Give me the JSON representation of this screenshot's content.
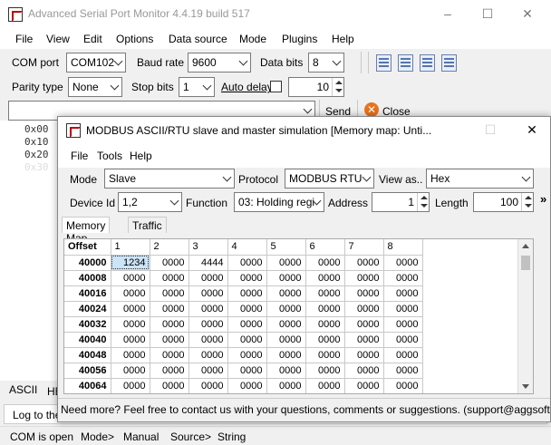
{
  "app": {
    "title": "Advanced Serial Port Monitor 4.4.19 build 517",
    "menu": [
      "File",
      "View",
      "Edit",
      "Options",
      "Data source",
      "Mode",
      "Plugins",
      "Help"
    ]
  },
  "settings": {
    "com_port_label": "COM port",
    "com_port": "COM102",
    "baud_label": "Baud rate",
    "baud": "9600",
    "databits_label": "Data bits",
    "databits": "8",
    "parity_label": "Parity type",
    "parity": "None",
    "stopbits_label": "Stop bits",
    "stopbits": "1",
    "autodelay_label": "Auto delay",
    "autodelay_value": "10",
    "send_label": "Send",
    "close_label": "Close"
  },
  "terminal": {
    "lines": [
      "0x00",
      "0x10",
      "0x20",
      "0x30"
    ]
  },
  "bottom": {
    "tab_ascii": "ASCII",
    "tab_h": "HE",
    "log_label": "Log to the"
  },
  "statusbar": {
    "com": "COM is open",
    "mode": "Mode>",
    "mode_val": "Manual",
    "source": "Source>",
    "source_val": "String"
  },
  "child": {
    "title": "MODBUS ASCII/RTU slave and master simulation [Memory map: Unti...",
    "menu": [
      "File",
      "Tools",
      "Help"
    ],
    "mode_label": "Mode",
    "mode": "Slave",
    "protocol_label": "Protocol",
    "protocol": "MODBUS RTU",
    "viewas_label": "View as..",
    "viewas": "Hex",
    "deviceid_label": "Device Id",
    "deviceid": "1,2",
    "function_label": "Function",
    "function": "03: Holding regi",
    "address_label": "Address",
    "address": "1",
    "length_label": "Length",
    "length": "100",
    "more": "»",
    "tabs": [
      "Memory Map",
      "Traffic"
    ],
    "table": {
      "offset_header": "Offset",
      "columns": [
        "1",
        "2",
        "3",
        "4",
        "5",
        "6",
        "7",
        "8"
      ],
      "rows": [
        {
          "offset": "40000",
          "values": [
            "1234",
            "0000",
            "4444",
            "0000",
            "0000",
            "0000",
            "0000",
            "0000"
          ]
        },
        {
          "offset": "40008",
          "values": [
            "0000",
            "0000",
            "0000",
            "0000",
            "0000",
            "0000",
            "0000",
            "0000"
          ]
        },
        {
          "offset": "40016",
          "values": [
            "0000",
            "0000",
            "0000",
            "0000",
            "0000",
            "0000",
            "0000",
            "0000"
          ]
        },
        {
          "offset": "40024",
          "values": [
            "0000",
            "0000",
            "0000",
            "0000",
            "0000",
            "0000",
            "0000",
            "0000"
          ]
        },
        {
          "offset": "40032",
          "values": [
            "0000",
            "0000",
            "0000",
            "0000",
            "0000",
            "0000",
            "0000",
            "0000"
          ]
        },
        {
          "offset": "40040",
          "values": [
            "0000",
            "0000",
            "0000",
            "0000",
            "0000",
            "0000",
            "0000",
            "0000"
          ]
        },
        {
          "offset": "40048",
          "values": [
            "0000",
            "0000",
            "0000",
            "0000",
            "0000",
            "0000",
            "0000",
            "0000"
          ]
        },
        {
          "offset": "40056",
          "values": [
            "0000",
            "0000",
            "0000",
            "0000",
            "0000",
            "0000",
            "0000",
            "0000"
          ]
        },
        {
          "offset": "40064",
          "values": [
            "0000",
            "0000",
            "0000",
            "0000",
            "0000",
            "0000",
            "0000",
            "0000"
          ]
        }
      ]
    },
    "status": "Need more? Feel free to contact us with your questions, comments or suggestions. (support@aggsoft.c"
  }
}
